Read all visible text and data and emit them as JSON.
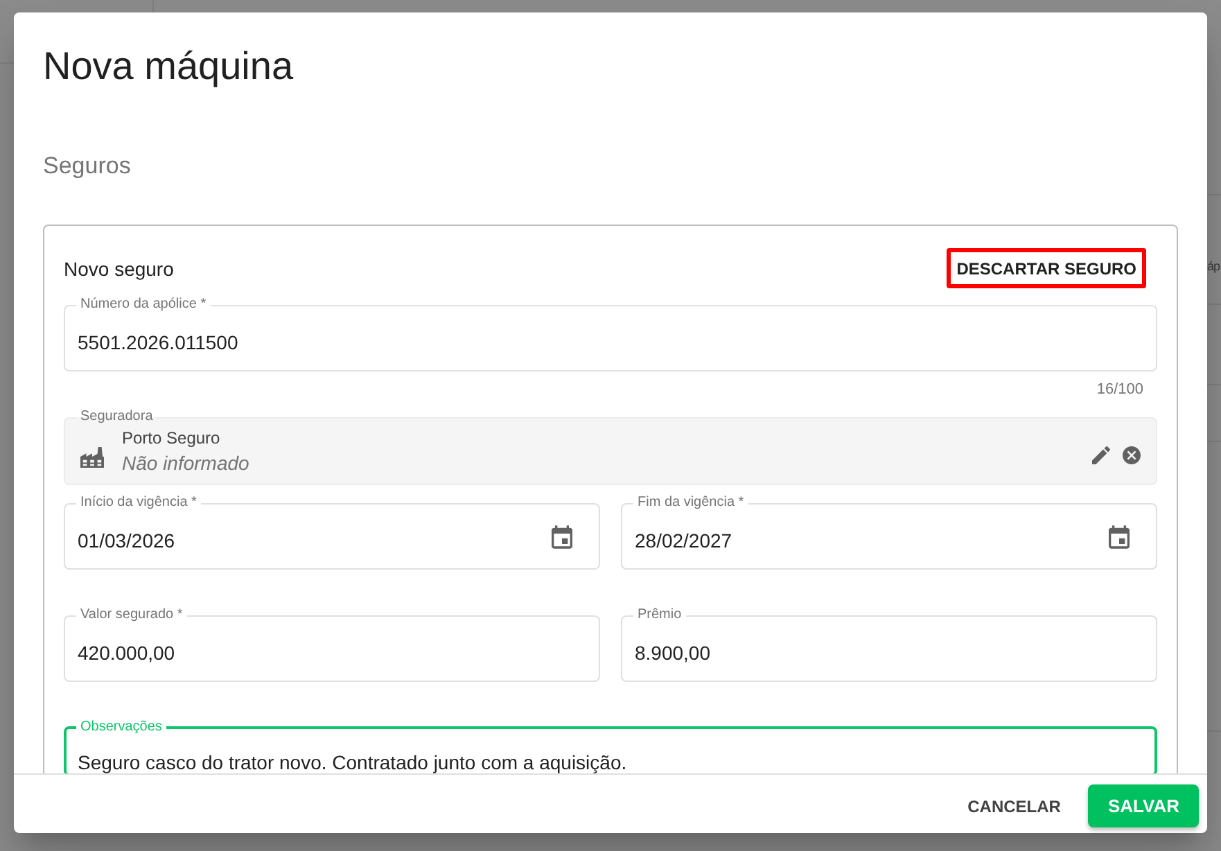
{
  "backdrop": {
    "text_fragment": "áp"
  },
  "dialog": {
    "title": "Nova máquina",
    "section_title": "Seguros",
    "insurance_card": {
      "title": "Novo seguro",
      "discard_button": {
        "label": "DESCARTAR SEGURO",
        "highlighted": true
      },
      "rows": [
        {
          "fields": [
            {
              "kind": "text",
              "label": "Número da apólice *",
              "value": "5501.2026.011500",
              "counter": "16/100",
              "focused": false
            }
          ]
        },
        {
          "fields": [
            {
              "kind": "lookup",
              "label": "Seguradora",
              "value": "Porto Seguro",
              "secondary": "Não informado",
              "focused": false
            }
          ]
        },
        {
          "fields": [
            {
              "kind": "date",
              "label": "Início da vigência *",
              "value": "01/03/2026",
              "focused": false
            },
            {
              "kind": "date",
              "label": "Fim da vigência *",
              "value": "28/02/2027",
              "focused": false
            }
          ]
        },
        {
          "fields": [
            {
              "kind": "text",
              "label": "Valor segurado *",
              "value": "420.000,00",
              "focused": false
            },
            {
              "kind": "text",
              "label": "Prêmio",
              "value": "8.900,00",
              "focused": false
            }
          ]
        },
        {
          "fields": [
            {
              "kind": "textarea",
              "label": "Observações",
              "value": "Seguro casco do trator novo. Contratado junto com a aquisição.",
              "focused": true
            }
          ]
        }
      ]
    },
    "footer_buttons": [
      {
        "kind": "text",
        "label": "CANCELAR"
      },
      {
        "kind": "primary",
        "label": "SALVAR"
      }
    ]
  }
}
